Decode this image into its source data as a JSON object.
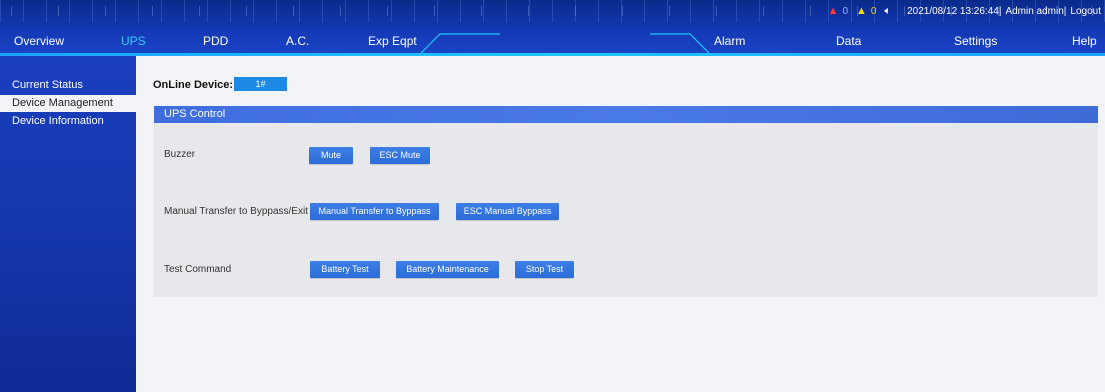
{
  "header": {
    "alarm_critical_count": "0",
    "alarm_warning_count": "0",
    "datetime": "2021/08/12 13:26:44|",
    "user": "Admin admin|",
    "logout": "Logout"
  },
  "nav": {
    "overview": "Overview",
    "ups": "UPS",
    "pdd": "PDD",
    "ac": "A.C.",
    "exp_eqpt": "Exp Eqpt",
    "alarm": "Alarm",
    "data": "Data",
    "settings": "Settings",
    "help": "Help"
  },
  "sidebar": {
    "items": [
      {
        "label": "Current Status"
      },
      {
        "label": "Device Management"
      },
      {
        "label": "Device Information"
      }
    ]
  },
  "main": {
    "online_label": "OnLine Device:",
    "online_value": "1#",
    "panel_title": "UPS Control",
    "rows": [
      {
        "label": "Buzzer",
        "buttons": [
          "Mute",
          "ESC Mute"
        ]
      },
      {
        "label": "Manual Transfer to Byppass/Exit",
        "buttons": [
          "Manual Transfer to Byppass",
          "ESC Manual Byppass"
        ]
      },
      {
        "label": "Test Command",
        "buttons": [
          "Battery Test",
          "Battery Maintenance",
          "Stop Test"
        ]
      }
    ]
  },
  "colors": {
    "topbar": "#1439b4",
    "sidebar": "#1534a8",
    "active_nav": "#3ec7ff",
    "button": "#2c6bd8",
    "panel_header": "#4a7ae6",
    "alarm_critical": "#ff3b30",
    "alarm_warning": "#ffd60a"
  }
}
